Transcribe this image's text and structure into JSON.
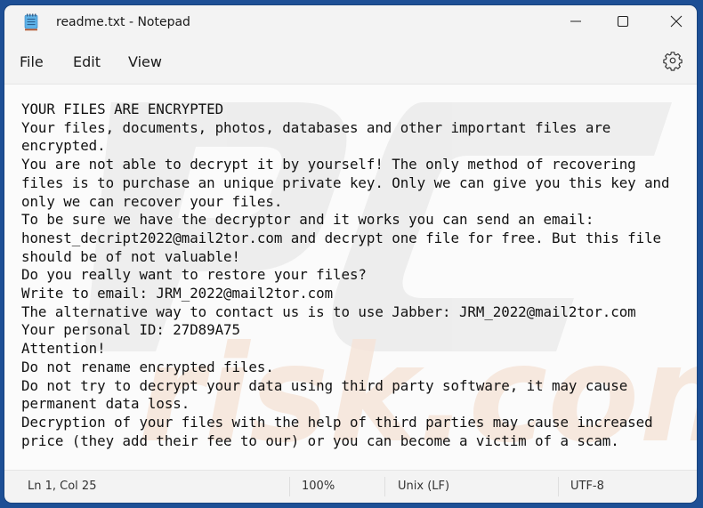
{
  "window": {
    "title": "readme.txt - Notepad",
    "app_icon": "notepad-icon",
    "controls": {
      "minimize": "minimize-icon",
      "maximize": "maximize-icon",
      "close": "close-icon"
    }
  },
  "menu": {
    "items": [
      {
        "label": "File"
      },
      {
        "label": "Edit"
      },
      {
        "label": "View"
      }
    ],
    "settings_icon": "gear-icon"
  },
  "editor": {
    "content": "YOUR FILES ARE ENCRYPTED\nYour files, documents, photos, databases and other important files are\nencrypted.\nYou are not able to decrypt it by yourself! The only method of recovering\nfiles is to purchase an unique private key. Only we can give you this key and\nonly we can recover your files.\nTo be sure we have the decryptor and it works you can send an email:\nhonest_decript2022@mail2tor.com and decrypt one file for free. But this file\nshould be of not valuable!\nDo you really want to restore your files?\nWrite to email: JRM_2022@mail2tor.com\nThe alternative way to contact us is to use Jabber: JRM_2022@mail2tor.com\nYour personal ID: 27D89A75\nAttention!\nDo not rename encrypted files.\nDo not try to decrypt your data using third party software, it may cause\npermanent data loss.\nDecryption of your files with the help of third parties may cause increased\nprice (they add their fee to our) or you can become a victim of a scam.",
    "watermark": "pcrisk.com"
  },
  "status": {
    "position": "Ln 1, Col 25",
    "zoom": "100%",
    "line_ending": "Unix (LF)",
    "encoding": "UTF-8"
  },
  "colors": {
    "desktop": "#1d4f95",
    "window": "#f3f3f3",
    "editor": "#fbfbfb"
  }
}
